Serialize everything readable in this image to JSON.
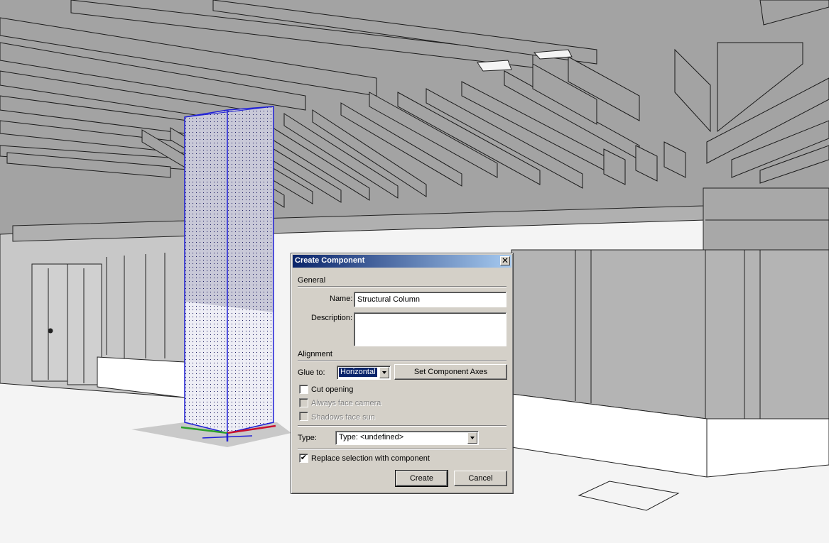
{
  "dialog": {
    "title": "Create Component",
    "close_symbol": "✕",
    "general": {
      "section_label": "General",
      "name_label": "Name:",
      "name_value": "Structural Column",
      "description_label": "Description:",
      "description_value": ""
    },
    "alignment": {
      "section_label": "Alignment",
      "glue_label": "Glue to:",
      "glue_value": "Horizontal",
      "set_axes_label": "Set Component Axes",
      "cut_opening_label": "Cut opening",
      "cut_opening_checked": false,
      "always_face_camera_label": "Always face camera",
      "always_face_camera_enabled": false,
      "shadows_face_sun_label": "Shadows face sun",
      "shadows_face_sun_enabled": false
    },
    "type": {
      "label": "Type:",
      "value": "Type: <undefined>"
    },
    "replace_selection": {
      "label": "Replace selection with component",
      "checked": true,
      "check_symbol": "✔"
    },
    "buttons": {
      "create_label": "Create",
      "cancel_label": "Cancel"
    }
  },
  "icons": {
    "dropdown": "chevron-down-icon",
    "close": "close-icon",
    "checkmark": "checkmark-icon"
  },
  "colors": {
    "titlebar_start": "#0a246a",
    "titlebar_end": "#a6caf0",
    "dialog_face": "#d4d0c8",
    "selection_highlight": "#0a246a",
    "model_gray": "#a3a3a3",
    "selection_blue": "#1f1fd6",
    "axis_red": "#c8102e",
    "axis_green": "#2ca02c",
    "axis_blue": "#1f1fd6"
  }
}
